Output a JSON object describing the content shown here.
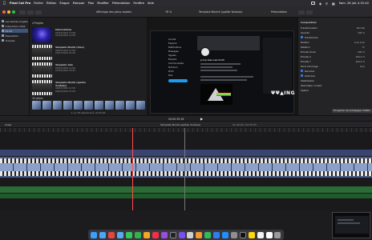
{
  "menubar": {
    "app_name": "Final Cut Pro",
    "menus": [
      "Fichier",
      "Édition",
      "Élague",
      "Marquer",
      "Plan",
      "Modifier",
      "Présentation",
      "Fenêtre",
      "Aide"
    ],
    "clock": "Sam. 26 juil. à 01:42"
  },
  "toolbar": {
    "viewer_label": "Affichage des plans rapides",
    "zoom": "78 %",
    "project_title": "Template Montré (spidée Youtube)",
    "view_label": "Présentation"
  },
  "sidebar": {
    "items": [
      {
        "label": "Les Alertes Anglais",
        "selected": false
      },
      {
        "label": "Collections intell.",
        "selected": false
      },
      {
        "label": "02.04",
        "selected": true
      },
      {
        "label": "Dissolution",
        "selected": false
      },
      {
        "label": "Youtube",
        "selected": false
      }
    ]
  },
  "browser": {
    "header": "4 Projets",
    "clips": [
      {
        "title": "Informations",
        "meta": "02/02/2024 13:08\n01/09/2024 14:08"
      },
      {
        "title": "Template Monté (Aion)",
        "meta": "09/02/2024 17:09\n03/07/2024 22:02"
      },
      {
        "title": "Template vide",
        "meta": "05/02/2024 11:00\n07/02/2024 18:23"
      },
      {
        "title": "Template Monté (spidée Youtube)",
        "meta": "06/02/2024 11:50\n09/02/2024 21:09"
      }
    ],
    "strip_header": "34 plans",
    "footer": "1 sur 38 sélectionné, 01:00:00"
  },
  "inspector": {
    "title": "Composition",
    "rows": [
      {
        "label": "Transformation",
        "value": "Normal"
      },
      {
        "label": "Opacité",
        "value": "100 %"
      },
      {
        "label": "Transformer",
        "value": ""
      },
      {
        "label": "Position",
        "value": "0 px   0 px"
      },
      {
        "label": "Rotation",
        "value": "0°"
      },
      {
        "label": "Échelle (tout)",
        "value": "100 %"
      },
      {
        "label": "Échelle X",
        "value": "100.0 %"
      },
      {
        "label": "Échelle Y",
        "value": "100.0 %"
      },
      {
        "label": "Point d'ancrage",
        "value": "0 px"
      },
      {
        "label": "Recadrer",
        "value": ""
      },
      {
        "label": "Déformer",
        "value": ""
      },
      {
        "label": "Stabilisation",
        "value": ""
      },
      {
        "label": "Obturateur roulant",
        "value": ""
      },
      {
        "label": "Spatial",
        "value": ""
      }
    ],
    "footer_button": "Enregistrer les préréglages d'effets"
  },
  "playbar": {
    "timecode": "00:00:39:18"
  },
  "timeline": {
    "index_label": "Index",
    "project_title": "Template Monté (spidée Youtube)",
    "duration": "01:00:00 / 02:35:55"
  },
  "viewer_screen": {
    "nav_items": [
      "Accueil",
      "Explorer",
      "Notifications",
      "Messages",
      "Signets",
      "Emplois",
      "Communautés",
      "Premium",
      "Profil",
      "Plus"
    ],
    "post_label": "Poster",
    "profile_name": "Jump Idea Lab Profil",
    "brand": "ΨΨ▲ING"
  },
  "dock": {
    "apps": [
      "Finder",
      "Safari",
      "Chrome",
      "Mail",
      "Messages",
      "FaceTime",
      "Photos",
      "Musique",
      "Podcasts",
      "Final Cut Pro",
      "Motion",
      "Compressor",
      "Pages",
      "Numbers",
      "Keynote",
      "App Store",
      "Réglages",
      "Terminal",
      "Notes",
      "Rappels",
      "Calendrier",
      "Corbeille"
    ]
  }
}
